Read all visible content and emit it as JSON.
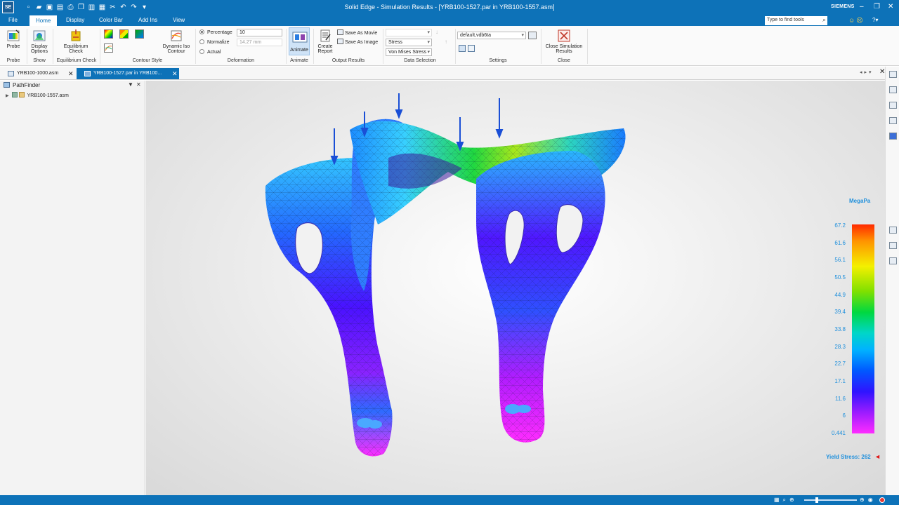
{
  "app": {
    "logo": "SE",
    "title": "Solid Edge - Simulation Results - [YRB100-1527.par in YRB100-1557.asm]",
    "brand": "SIEMENS"
  },
  "menu": {
    "tabs": [
      "File",
      "Home",
      "Display",
      "Color Bar",
      "Add Ins",
      "View"
    ],
    "search_placeholder": "Type to find tools"
  },
  "ribbon": {
    "probe": {
      "label": "Probe",
      "group": "Probe"
    },
    "display_options": {
      "label1": "Display",
      "label2": "Options",
      "group": "Show"
    },
    "equilibrium": {
      "label1": "Equilibrium",
      "label2": "Check",
      "group": "Equilibrium Check"
    },
    "contour_style": {
      "group": "Contour Style"
    },
    "dynamic_iso": {
      "label1": "Dynamic Iso",
      "label2": "Contour"
    },
    "deformation": {
      "group": "Deformation",
      "options": [
        "Percentage",
        "Normalize",
        "Actual"
      ],
      "selected": "Percentage",
      "percentage_value": "10",
      "normalize_value": "14.27 mm"
    },
    "animate": {
      "label": "Animate",
      "group": "Animate"
    },
    "create_report": {
      "label1": "Create",
      "label2": "Report"
    },
    "save_movie": "Save As Movie",
    "save_image": "Save As Image",
    "output_results": {
      "group": "Output Results"
    },
    "data_selection": {
      "group": "Data Selection",
      "result_type": "Stress",
      "component": "Von Mises Stress"
    },
    "settings": {
      "group": "Settings",
      "preset": "default,vdb6ta"
    },
    "close": {
      "label1": "Close Simulation",
      "label2": "Results",
      "group": "Close"
    }
  },
  "doc_tabs": [
    {
      "label": "YRB100-1000.asm",
      "active": false
    },
    {
      "label": "YRB100-1527.par in YRB100...",
      "active": true
    }
  ],
  "pathfinder": {
    "title": "PathFinder",
    "tree": [
      {
        "label": "YRB100-1557.asm"
      }
    ]
  },
  "legend": {
    "unit": "MegaPa",
    "ticks": [
      "67.2",
      "61.6",
      "56.1",
      "50.5",
      "44.9",
      "39.4",
      "33.8",
      "28.3",
      "22.7",
      "17.1",
      "11.6",
      "6",
      "0.441"
    ],
    "yield_label": "Yield Stress: 262"
  },
  "colors": {
    "accent": "#0d72b8",
    "legend_text": "#1e8fdc",
    "stress_max": "#ff2a00",
    "stress_min": "#ff2cff"
  }
}
